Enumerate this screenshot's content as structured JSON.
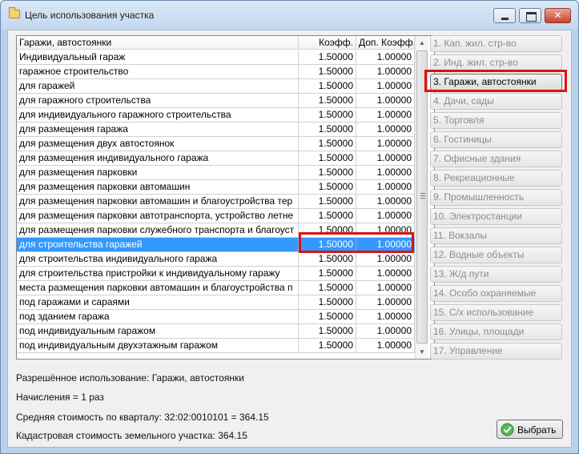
{
  "window": {
    "title": "Цель использования участка",
    "controls": {
      "minimize_icon": "minimize-icon",
      "maximize_icon": "maximize-icon",
      "close_icon": "close-icon",
      "close_glyph": "✕"
    }
  },
  "table": {
    "headers": {
      "name": "Гаражи, автостоянки",
      "coef": "Коэфф.",
      "extra_coef": "Доп. Коэфф."
    },
    "selected_index": 13,
    "rows": [
      {
        "name": "Индивидуальный гараж",
        "coef": "1.50000",
        "extra": "1.00000"
      },
      {
        "name": "гаражное строительство",
        "coef": "1.50000",
        "extra": "1.00000"
      },
      {
        "name": "для гаражей",
        "coef": "1.50000",
        "extra": "1.00000"
      },
      {
        "name": "для гаражного строительства",
        "coef": "1.50000",
        "extra": "1.00000"
      },
      {
        "name": "для индивидуального гаражного строительства",
        "coef": "1.50000",
        "extra": "1.00000"
      },
      {
        "name": "для размещения гаража",
        "coef": "1.50000",
        "extra": "1.00000"
      },
      {
        "name": "для размещения двух автостоянок",
        "coef": "1.50000",
        "extra": "1.00000"
      },
      {
        "name": "для размещения индивидуального гаража",
        "coef": "1.50000",
        "extra": "1.00000"
      },
      {
        "name": "для размещения парковки",
        "coef": "1.50000",
        "extra": "1.00000"
      },
      {
        "name": "для размещения парковки автомашин",
        "coef": "1.50000",
        "extra": "1.00000"
      },
      {
        "name": "для размещения парковки автомашин и благоустройства тер",
        "coef": "1.50000",
        "extra": "1.00000"
      },
      {
        "name": "для размещения парковки автотранспорта, устройство летне",
        "coef": "1.50000",
        "extra": "1.00000"
      },
      {
        "name": "для размещения парковки служебного транспорта и благоуст",
        "coef": "1.50000",
        "extra": "1.00000"
      },
      {
        "name": "для строительства гаражей",
        "coef": "1.50000",
        "extra": "1.00000"
      },
      {
        "name": "для строительства индивидуального гаража",
        "coef": "1.50000",
        "extra": "1.00000"
      },
      {
        "name": "для строительства пристройки к индивидуальному гаражу",
        "coef": "1.50000",
        "extra": "1.00000"
      },
      {
        "name": "места размещения парковки автомашин и благоустройства п",
        "coef": "1.50000",
        "extra": "1.00000"
      },
      {
        "name": "под гаражами и сараями",
        "coef": "1.50000",
        "extra": "1.00000"
      },
      {
        "name": "под зданием гаража",
        "coef": "1.50000",
        "extra": "1.00000"
      },
      {
        "name": "под индивидуальным гаражом",
        "coef": "1.50000",
        "extra": "1.00000"
      },
      {
        "name": "под индивидуальным двухэтажным гаражом",
        "coef": "1.50000",
        "extra": "1.00000"
      }
    ],
    "scrollbar": {
      "up_glyph": "▲",
      "down_glyph": "▼"
    }
  },
  "categories": {
    "active_index": 2,
    "items": [
      "1. Кап. жил. стр-во",
      "2. Инд. жил. стр-во",
      "3. Гаражи, автостоянки",
      "4. Дачи, сады",
      "5. Торговля",
      "6. Гостиницы",
      "7. Офисные здания",
      "8. Рекреационные",
      "9. Промышленность",
      "10. Электростанции",
      "11. Вокзалы",
      "12. Водные объекты",
      "13. Ж/д пути",
      "14. Особо охраняемые",
      "15. С/х использование",
      "16. Улицы, площади",
      "17. Управление"
    ]
  },
  "info": {
    "allowed_use": "Разрешённое использование: Гаражи, автостоянки",
    "accruals": "Начисления = 1 раз",
    "avg_cost": "Средняя стоимость по кварталу: 32:02:0010101 = 364.15",
    "cadastral_cost": "Кадастровая стоимость земельного участка: 364.15"
  },
  "select_button": {
    "label": "Выбрать",
    "icon": "checkmark-icon"
  },
  "colors": {
    "selection": "#3399ff",
    "highlight": "#e01010",
    "window_frame": "#b9d1ea"
  }
}
